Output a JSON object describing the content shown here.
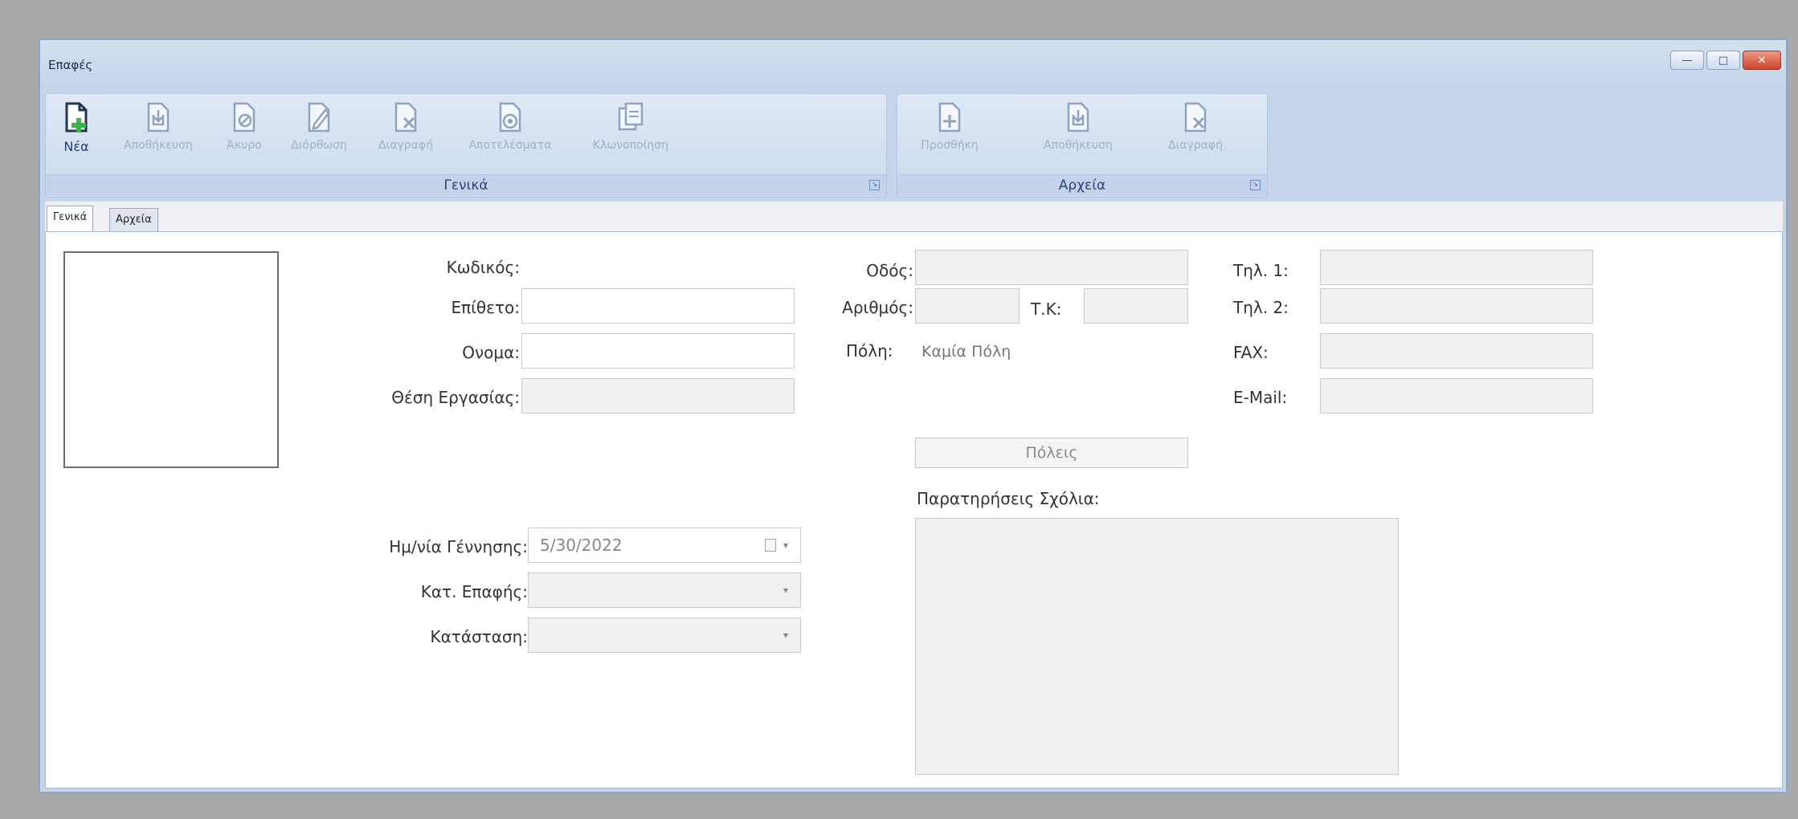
{
  "window": {
    "title": "Επαφές"
  },
  "ribbon": {
    "groups": [
      {
        "label": "Γενικά"
      },
      {
        "label": "Αρχεία"
      }
    ],
    "general_buttons": [
      {
        "label": "Νέα"
      },
      {
        "label": "Αποθήκευση"
      },
      {
        "label": "Άκυρο"
      },
      {
        "label": "Διόρθωση"
      },
      {
        "label": "Διαγραφή"
      },
      {
        "label": "Αποτελέσματα"
      },
      {
        "label": "Κλωνοποίηση"
      }
    ],
    "files_buttons": [
      {
        "label": "Προσθήκη"
      },
      {
        "label": "Αποθήκευση"
      },
      {
        "label": "Διαγραφή"
      }
    ]
  },
  "tabs": [
    {
      "label": "Γενικά"
    },
    {
      "label": "Αρχεία"
    }
  ],
  "form": {
    "code_label": "Κωδικός:",
    "surname_label": "Επίθετο:",
    "name_label": "Ονομα:",
    "job_label": "Θέση Εργασίας:",
    "street_label": "Οδός:",
    "number_label": "Αριθμός:",
    "postal_label": "Τ.Κ:",
    "city_label": "Πόλη:",
    "city_value": "Καμία Πόλη",
    "cities_button": "Πόλεις",
    "notes_label": "Παρατηρήσεις Σχόλια:",
    "phone1_label": "Τηλ. 1:",
    "phone2_label": "Τηλ. 2:",
    "fax_label": "FAX:",
    "email_label": "E-Mail:",
    "birth_label": "Ημ/νία Γέννησης:",
    "birth_value": "5/30/2022",
    "category_label": "Κατ. Επαφής:",
    "status_label": "Κατάσταση:"
  },
  "colors": {
    "ribbon_bg": "#c5d5ea",
    "accent_green": "#3bb54a",
    "active_text": "#1f3f7a",
    "disabled_text": "#9db0ca"
  }
}
